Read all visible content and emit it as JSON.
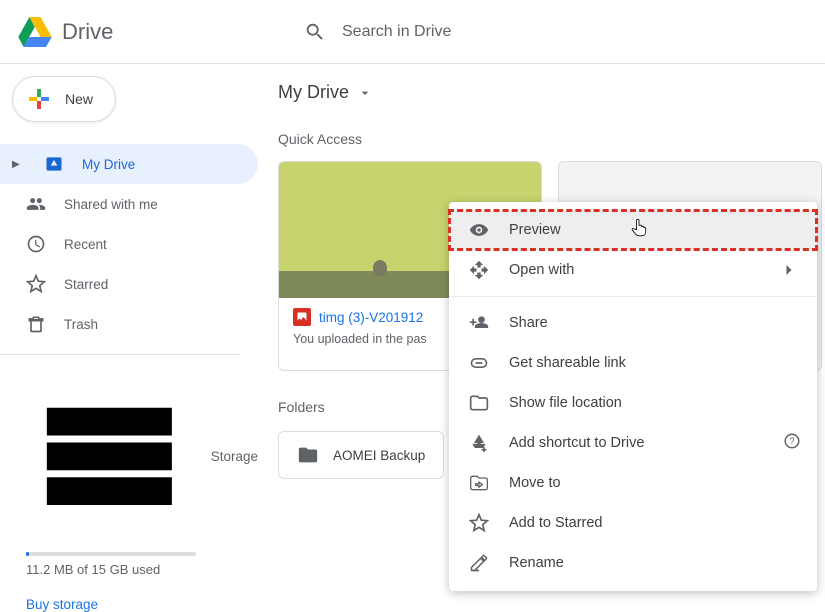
{
  "header": {
    "app_name": "Drive",
    "search_placeholder": "Search in Drive"
  },
  "sidebar": {
    "new_label": "New",
    "items": [
      {
        "label": "My Drive"
      },
      {
        "label": "Shared with me"
      },
      {
        "label": "Recent"
      },
      {
        "label": "Starred"
      },
      {
        "label": "Trash"
      }
    ],
    "storage_label": "Storage",
    "storage_text": "11.2 MB of 15 GB used",
    "buy_label": "Buy storage"
  },
  "main": {
    "breadcrumb": "My Drive",
    "quick_access_title": "Quick Access",
    "quick_card": {
      "title": "timg (3)-V201912",
      "subtitle": "You uploaded in the pas"
    },
    "folders_title": "Folders",
    "folder_name": "AOMEI Backup"
  },
  "context_menu": {
    "items": [
      {
        "label": "Preview"
      },
      {
        "label": "Open with"
      },
      {
        "label": "Share"
      },
      {
        "label": "Get shareable link"
      },
      {
        "label": "Show file location"
      },
      {
        "label": "Add shortcut to Drive"
      },
      {
        "label": "Move to"
      },
      {
        "label": "Add to Starred"
      },
      {
        "label": "Rename"
      }
    ]
  }
}
